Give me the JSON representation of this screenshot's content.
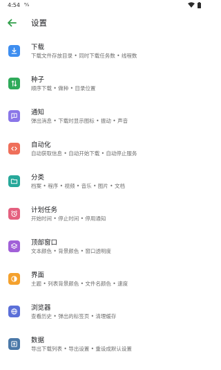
{
  "status_bar": {
    "time": "4:54",
    "nfc": "ᴺ⁄ₐ"
  },
  "app_bar": {
    "title": "设置"
  },
  "items": [
    {
      "label": "下载",
      "subtitle": "下载文件存放目录 • 同时下载任务数 • 线程数",
      "icon": "download-icon",
      "color": "#3e8ef0"
    },
    {
      "label": "种子",
      "subtitle": "顺序下载 • 做种 • 目录位置",
      "icon": "torrent-icon",
      "color": "#2faa5a"
    },
    {
      "label": "通知",
      "subtitle": "弹出消息 • 下载时显示图标 • 振动 • 声音",
      "icon": "notification-icon",
      "color": "#8a76e8"
    },
    {
      "label": "自动化",
      "subtitle": "自动获取信息 • 自动开始下载 • 自动停止服务",
      "icon": "automation-icon",
      "color": "#ef6f5a"
    },
    {
      "label": "分类",
      "subtitle": "档案 • 程序 • 视频 • 音乐 • 图片 • 文档",
      "icon": "folder-icon",
      "color": "#27a89a"
    },
    {
      "label": "计划任务",
      "subtitle": "开始时间 • 停止时间 • 停用通知",
      "icon": "alarm-icon",
      "color": "#e4607f"
    },
    {
      "label": "顶部窗口",
      "subtitle": "文本颜色 • 背景颜色 • 窗口透明度",
      "icon": "layers-icon",
      "color": "#a160d8"
    },
    {
      "label": "界面",
      "subtitle": "主题 • 列表背景颜色 • 文件名颜色 • 速度",
      "icon": "theme-icon",
      "color": "#f4a12d"
    },
    {
      "label": "浏览器",
      "subtitle": "查看历史 • 弹出的标签页 • 清理缓存",
      "icon": "globe-icon",
      "color": "#5b6fd8"
    },
    {
      "label": "数据",
      "subtitle": "导出下载列表 • 导出设置 • 重设成默认设置",
      "icon": "backup-icon",
      "color": "#4a78a8"
    }
  ]
}
